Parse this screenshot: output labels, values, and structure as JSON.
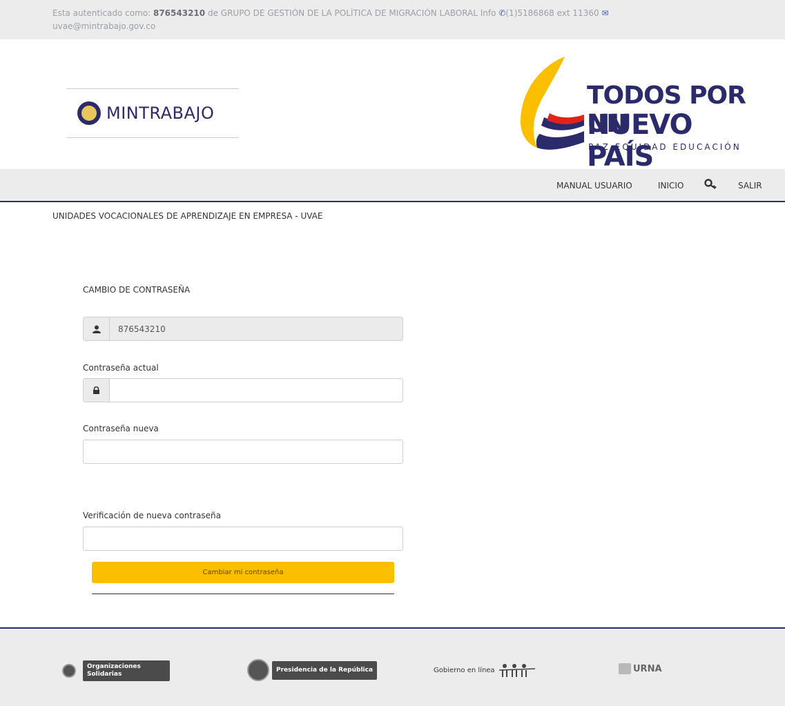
{
  "topbar": {
    "prefix": "Esta autenticado como:",
    "user_id": "876543210",
    "org": "de GRUPO DE GESTIÓN DE LA POLÍTICA DE MIGRACIÓN LABORAL",
    "info_label": "Info",
    "phone": "(1)5186868 ext 11360",
    "email": "uvae@mintrabajo.gov.co"
  },
  "logos": {
    "mintrabajo": "MINTRABAJO",
    "tpnp_line1": "TODOS POR UN",
    "tpnp_line2": "NUEVO PAÍS",
    "tpnp_line3": "PAZ  EQUIDAD  EDUCACIÓN",
    "tpnp_colors": [
      "#fbbf00",
      "#2b2a6b",
      "#e2231a"
    ]
  },
  "nav": {
    "manual": "MANUAL USUARIO",
    "inicio": "INICIO",
    "key_icon": "key-icon",
    "salir": "SALIR"
  },
  "page_title": "UNIDADES VOCACIONALES DE APRENDIZAJE EN EMPRESA - UVAE",
  "form": {
    "title": "CAMBIO DE CONTRASEÑA",
    "username_value": "876543210",
    "user_icon": "user-icon",
    "lock_icon": "lock-icon",
    "current_label": "Contraseña actual",
    "new_label": "Contraseña nueva",
    "verify_label": "Verificación de nueva contraseña",
    "submit": "Cambiar mi contraseña"
  },
  "footer": {
    "org_solidarias": "Organizaciones Solidarias",
    "presidencia": "Presidencia de la República",
    "gobierno": "Gobierno en línea",
    "urna": "URNA"
  },
  "colors": {
    "accent": "#2b2a6b",
    "button": "#fbbf00",
    "bar": "#ececec"
  }
}
